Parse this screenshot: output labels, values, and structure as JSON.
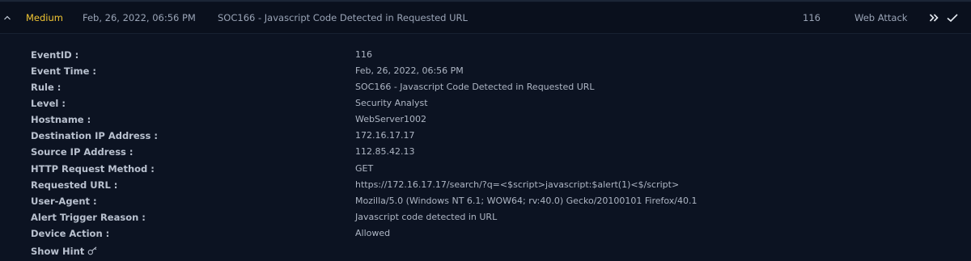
{
  "alert": {
    "severity": "Medium",
    "date": "Feb, 26, 2022, 06:56 PM",
    "rule": "SOC166 - Javascript Code Detected in Requested URL",
    "event_id": "116",
    "type": "Web Attack"
  },
  "details": [
    {
      "label": "EventID :",
      "value": "116"
    },
    {
      "label": "Event Time :",
      "value": "Feb, 26, 2022, 06:56 PM"
    },
    {
      "label": "Rule :",
      "value": "SOC166 - Javascript Code Detected in Requested URL"
    },
    {
      "label": "Level :",
      "value": "Security Analyst"
    },
    {
      "label": "Hostname :",
      "value": "WebServer1002"
    },
    {
      "label": "Destination IP Address :",
      "value": "172.16.17.17"
    },
    {
      "label": "Source IP Address :",
      "value": "112.85.42.13"
    },
    {
      "label": "HTTP Request Method :",
      "value": "GET"
    },
    {
      "label": "Requested URL :",
      "value": "https://172.16.17.17/search/?q=<$script>javascript:$alert(1)<$/script>"
    },
    {
      "label": "User-Agent :",
      "value": "Mozilla/5.0 (Windows NT 6.1; WOW64; rv:40.0) Gecko/20100101 Firefox/40.1"
    },
    {
      "label": "Alert Trigger Reason :",
      "value": "Javascript code detected in URL"
    },
    {
      "label": "Device Action :",
      "value": "Allowed"
    }
  ],
  "show_hint_label": "Show Hint",
  "icons": {
    "collapse": "chevron-up-icon",
    "forward": "double-chevron-right-icon",
    "check": "checkmark-icon",
    "hint": "key-icon"
  },
  "colors": {
    "severity_medium": "#f2c633",
    "background": "#0c1322"
  }
}
